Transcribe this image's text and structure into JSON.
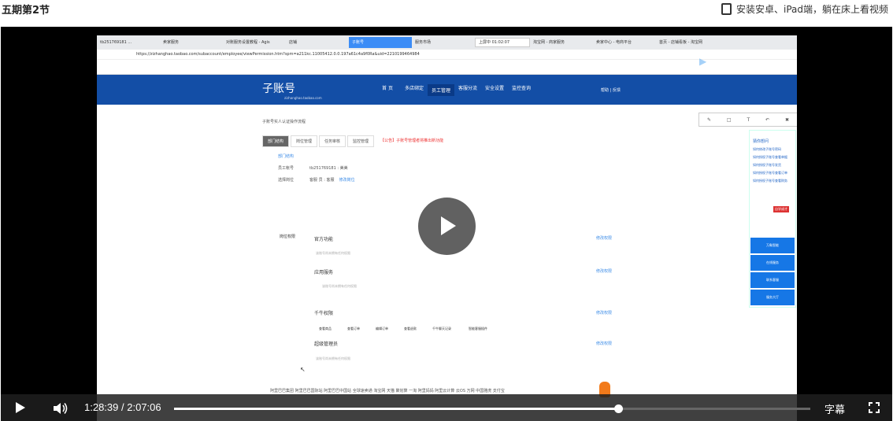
{
  "page": {
    "title": "五期第2节",
    "device_note": "安装安卓、iPad端，躺在床上看视频"
  },
  "video_frame": {
    "browser_tabs": [
      "tb25176918​1 ...",
      "卖家服务",
      "对账服务设置教程 - Agis",
      "店铺",
      "子账号",
      "服务市场",
      "上屏中 01:02:07",
      "淘宝网 - 商家服务",
      "卖家中心 - 电商平台",
      "首页 - 店铺看板 - 淘宝网"
    ],
    "address": "https://zizhanghao.taobao.com/subaccount/employee/viewPermission.htm?spm=a211kc.11005412.0.0.197a61c4a9f0Ra&uid=2210199464984",
    "site_logo": "子账号",
    "site_logo_sub": "zizhanghao.taobao.com",
    "nav": [
      "首 页",
      "多店绑定",
      "员工管理",
      "客服分流",
      "安全设置",
      "监控查询"
    ],
    "nav_active_index": 2,
    "help": "帮助 | 反馈",
    "notice": "子账号实人认证操作流程",
    "content_tabs": [
      "部门结构",
      "岗位管理",
      "任务审核",
      "监控管理"
    ],
    "announcement": "【公告】子账号管理者将推出新功能",
    "breadcrumb": "部门结构",
    "employee_label": "员工帐号",
    "employee_value": "tb25176918​1 : 美美",
    "position_label": "选择岗位",
    "position_value": "客服 员 : 客服",
    "position_link": "修改岗位",
    "perm_label": "岗位权限",
    "sections": [
      {
        "title": "官方功能",
        "edit": "修改权限",
        "note": "该账号尚未拥有任何权限"
      },
      {
        "title": "应用服务",
        "edit": "修改权限",
        "note": "该账号尚未拥有任何权限"
      },
      {
        "title": "千牛权限",
        "edit": "修改权限"
      },
      {
        "title": "超级管理员",
        "edit": "修改权限",
        "note": "该账号尚未拥有任何权限"
      }
    ],
    "qianniu_items": [
      "查看商品",
      "查看订单",
      "编辑订单",
      "查看退款",
      "千牛聊天记录",
      "智能客服插件"
    ],
    "footer_links": "阿里巴巴集团   阿里巴巴国际站   阿里巴巴中国站   全球速卖通   淘宝网   天猫   聚划算   一淘   阿里妈妈   阿里云计算   云OS   万网   中国雅虎   支付宝",
    "right_panel": {
      "title": "猜你想问",
      "items": [
        "如何修改子账号密码",
        "如何授权子账号查看单据",
        "如何授权子账号发货",
        "如何授权子账号查看订单",
        "如何授权子账号查看财务"
      ],
      "promo": "自学成才",
      "buttons": [
        "万象智能",
        "在线服务",
        "联系客服",
        "服务大厅"
      ]
    }
  },
  "controls": {
    "current_time": "1:28:39",
    "separator": "/",
    "duration": "2:07:06",
    "progress": 0.6975,
    "subtitles": "字幕"
  }
}
